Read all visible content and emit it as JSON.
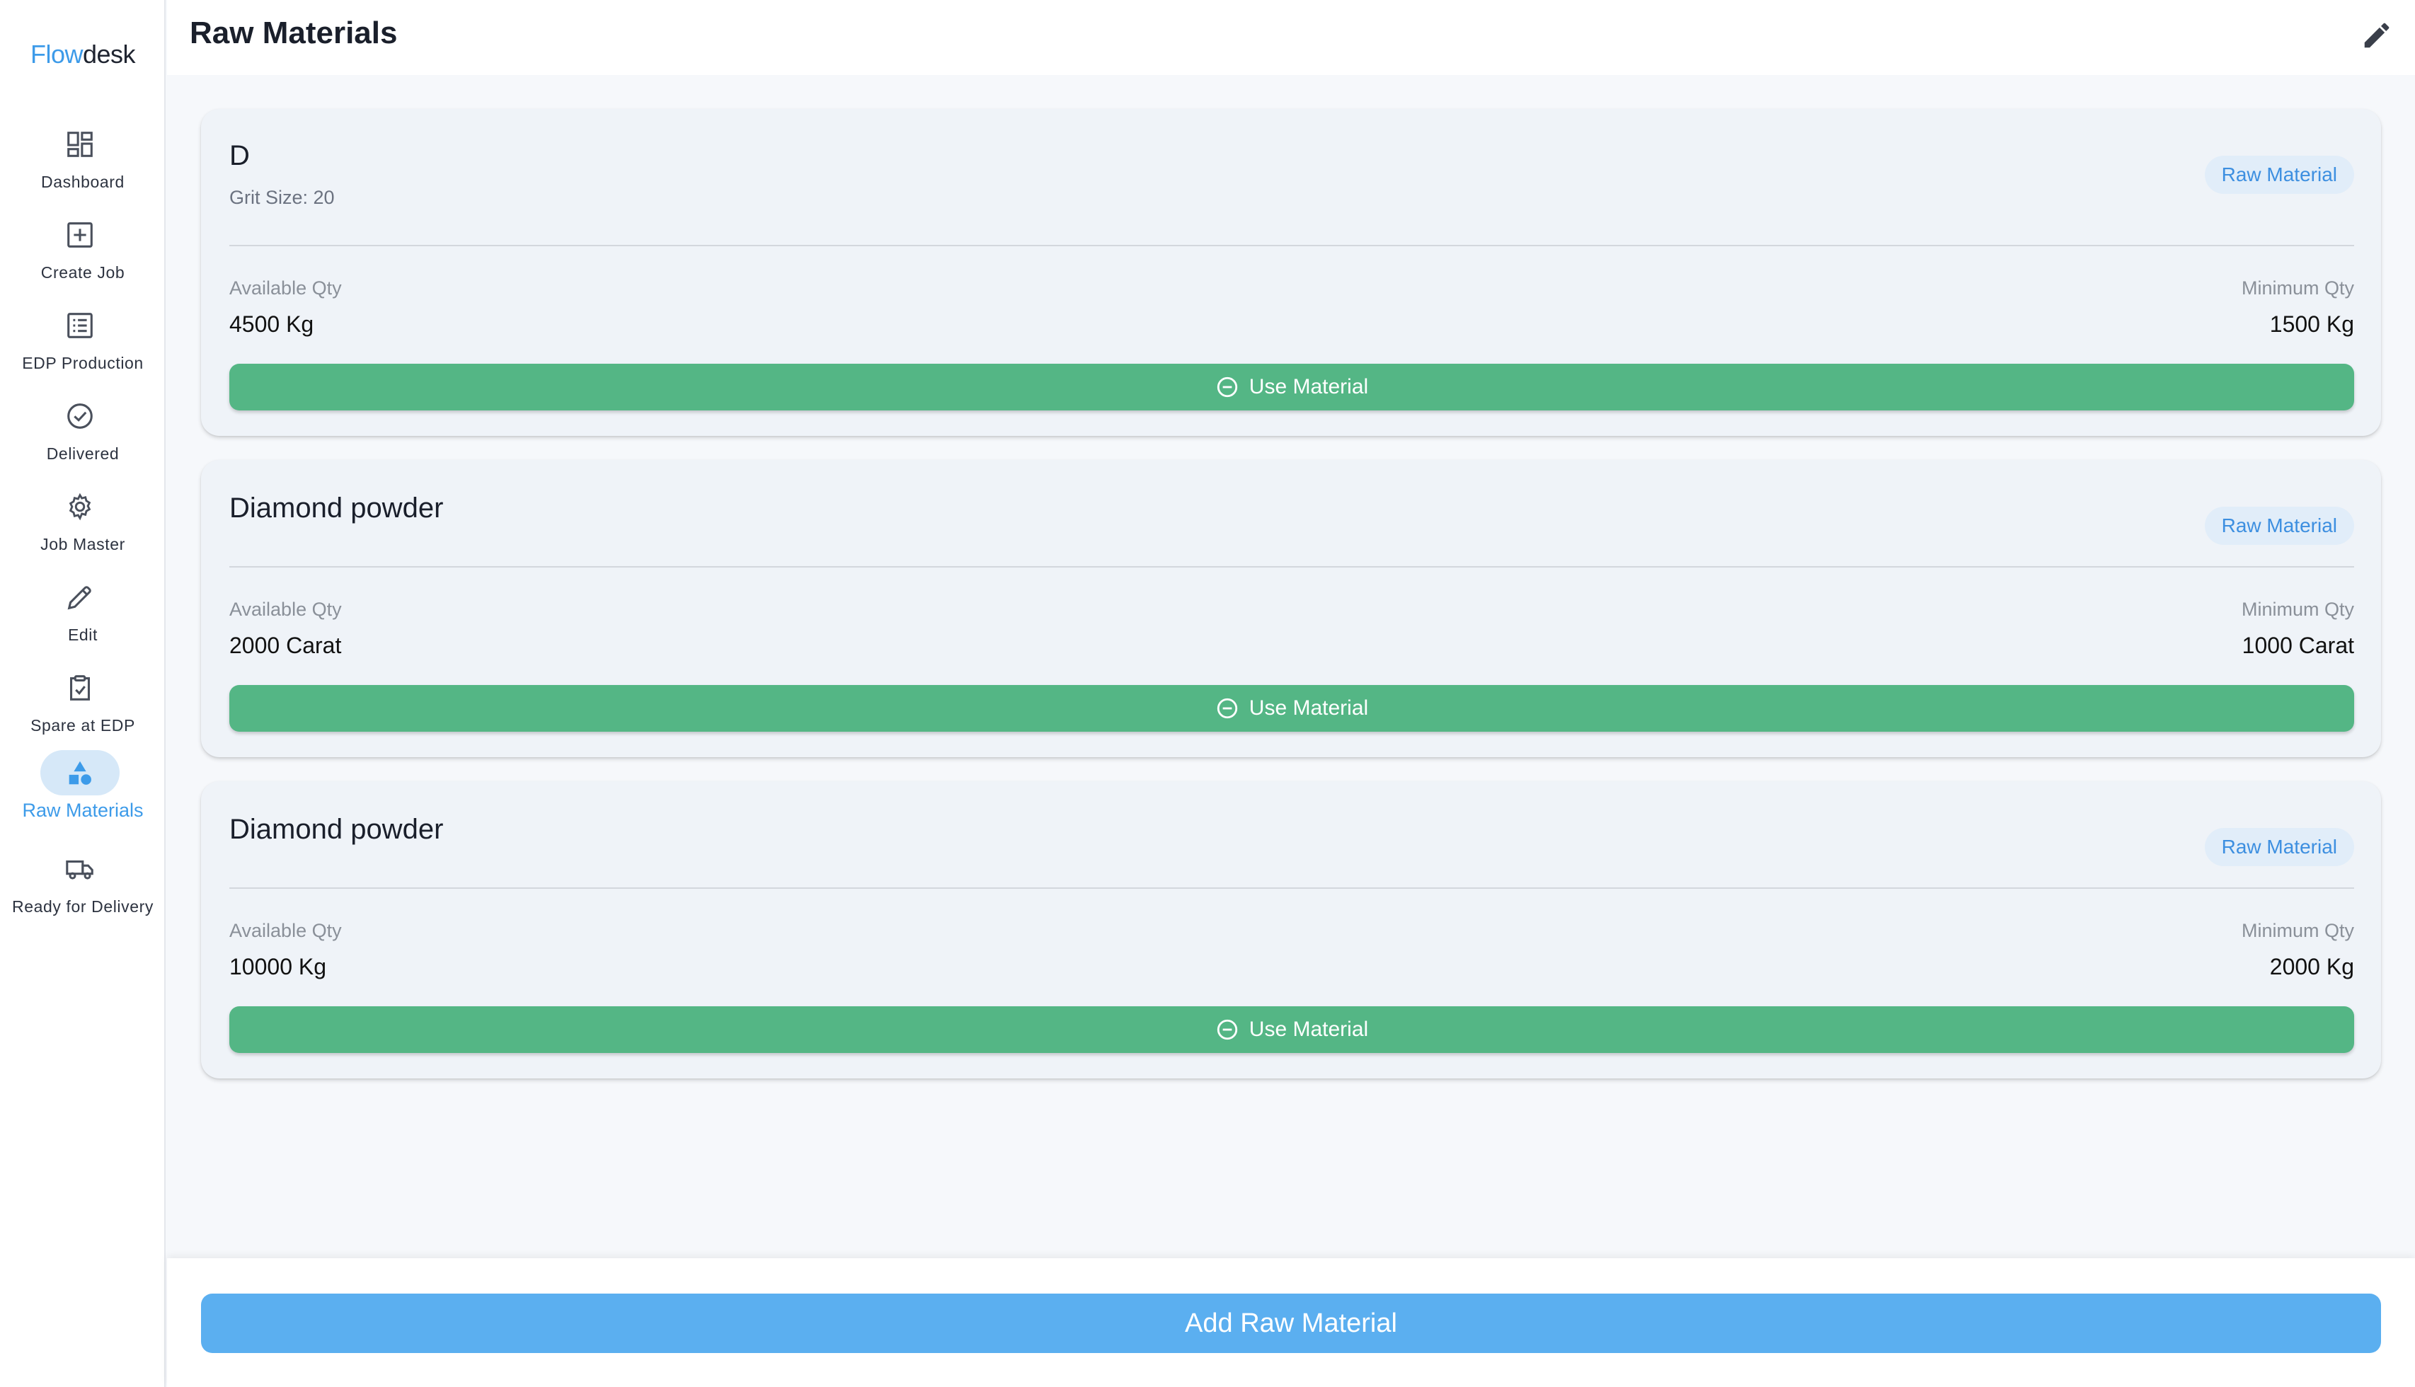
{
  "app": {
    "logo_part1": "Flow",
    "logo_part2": "desk"
  },
  "sidebar": {
    "items": [
      {
        "label": "Dashboard",
        "icon": "dashboard-icon"
      },
      {
        "label": "Create Job",
        "icon": "add-box-icon"
      },
      {
        "label": "EDP Production",
        "icon": "list-icon"
      },
      {
        "label": "Delivered",
        "icon": "check-circle-icon"
      },
      {
        "label": "Job Master",
        "icon": "gear-icon"
      },
      {
        "label": "Edit",
        "icon": "pencil-icon"
      },
      {
        "label": "Spare at EDP",
        "icon": "clipboard-check-icon"
      },
      {
        "label": "Raw Materials",
        "icon": "shapes-icon",
        "active": true
      },
      {
        "label": "Ready for Delivery",
        "icon": "truck-icon"
      }
    ]
  },
  "header": {
    "title": "Raw Materials"
  },
  "materials": [
    {
      "name": "D",
      "subtitle": "Grit Size: 20",
      "badge": "Raw Material",
      "available_label": "Available Qty",
      "available_value": "4500 Kg",
      "minimum_label": "Minimum Qty",
      "minimum_value": "1500 Kg",
      "action_label": "Use Material"
    },
    {
      "name": "Diamond powder",
      "badge": "Raw Material",
      "available_label": "Available Qty",
      "available_value": "2000 Carat",
      "minimum_label": "Minimum Qty",
      "minimum_value": "1000 Carat",
      "action_label": "Use Material"
    },
    {
      "name": "Diamond powder",
      "badge": "Raw Material",
      "available_label": "Available Qty",
      "available_value": "10000 Kg",
      "minimum_label": "Minimum Qty",
      "minimum_value": "2000 Kg",
      "action_label": "Use Material"
    }
  ],
  "footer": {
    "add_label": "Add Raw Material"
  },
  "colors": {
    "accent": "#3d9be9",
    "use_button": "#54b685",
    "add_button": "#5baff0",
    "card_bg": "#eff3f8"
  }
}
